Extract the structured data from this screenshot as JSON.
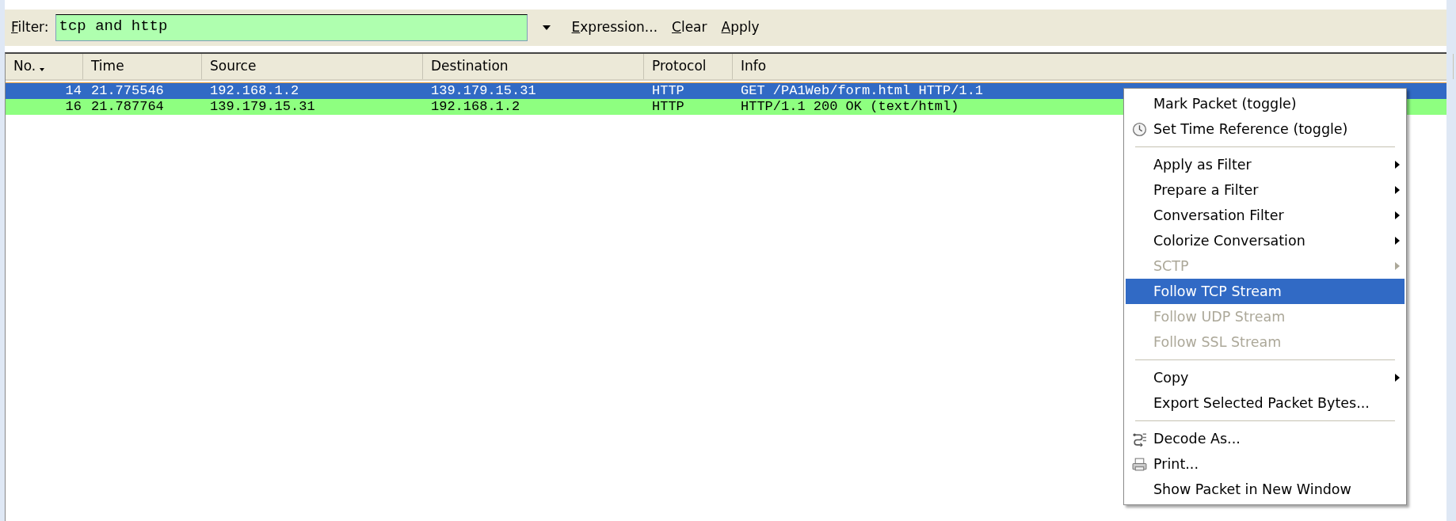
{
  "filter": {
    "label": "Filter:",
    "value": "tcp and http"
  },
  "filter_actions": [
    {
      "label": "Expression..."
    },
    {
      "label": "Clear"
    },
    {
      "label": "Apply"
    }
  ],
  "table": {
    "columns": [
      {
        "label": "No.",
        "sorted": true
      },
      {
        "label": "Time",
        "sorted": false
      },
      {
        "label": "Source",
        "sorted": false
      },
      {
        "label": "Destination",
        "sorted": false
      },
      {
        "label": "Protocol",
        "sorted": false
      },
      {
        "label": "Info",
        "sorted": false
      }
    ],
    "rows": [
      {
        "selected": true,
        "cells": [
          "14",
          "21.775546",
          "192.168.1.2",
          "139.179.15.31",
          "HTTP",
          "GET /PA1Web/form.html HTTP/1.1"
        ]
      },
      {
        "selected": false,
        "color": "#8eff80",
        "cells": [
          "16",
          "21.787764",
          "139.179.15.31",
          "192.168.1.2",
          "HTTP",
          "HTTP/1.1 200 OK  (text/html)"
        ]
      }
    ]
  },
  "context_menu": {
    "items": [
      {
        "kind": "item",
        "label": "Mark Packet (toggle)",
        "submenu": false,
        "disabled": false,
        "selected": false
      },
      {
        "kind": "icon_item",
        "label": "Set Time Reference (toggle)",
        "submenu": false,
        "disabled": false,
        "selected": false
      },
      {
        "kind": "separator"
      },
      {
        "kind": "item",
        "label": "Apply as Filter",
        "submenu": true,
        "disabled": false,
        "selected": false
      },
      {
        "kind": "item",
        "label": "Prepare a Filter",
        "submenu": true,
        "disabled": false,
        "selected": false
      },
      {
        "kind": "item",
        "label": "Conversation Filter",
        "submenu": true,
        "disabled": false,
        "selected": false
      },
      {
        "kind": "item",
        "label": "Colorize Conversation",
        "submenu": true,
        "disabled": false,
        "selected": false
      },
      {
        "kind": "item",
        "label": "SCTP",
        "submenu": true,
        "disabled": true,
        "selected": false
      },
      {
        "kind": "item",
        "label": "Follow TCP Stream",
        "submenu": false,
        "disabled": false,
        "selected": true
      },
      {
        "kind": "item",
        "label": "Follow UDP Stream",
        "submenu": false,
        "disabled": true,
        "selected": false
      },
      {
        "kind": "item",
        "label": "Follow SSL Stream",
        "submenu": false,
        "disabled": true,
        "selected": false
      },
      {
        "kind": "separator"
      },
      {
        "kind": "item",
        "label": "Copy",
        "submenu": true,
        "disabled": false,
        "selected": false
      },
      {
        "kind": "item",
        "label": "Export Selected Packet Bytes...",
        "submenu": false,
        "disabled": false,
        "selected": false
      },
      {
        "kind": "separator"
      },
      {
        "kind": "icon_item",
        "label": "Decode As...",
        "submenu": false,
        "disabled": false,
        "selected": false
      },
      {
        "kind": "icon_item",
        "label": "Print...",
        "submenu": false,
        "disabled": false,
        "selected": false
      },
      {
        "kind": "item",
        "label": "Show Packet in New Window",
        "submenu": false,
        "disabled": false,
        "selected": false
      }
    ]
  }
}
